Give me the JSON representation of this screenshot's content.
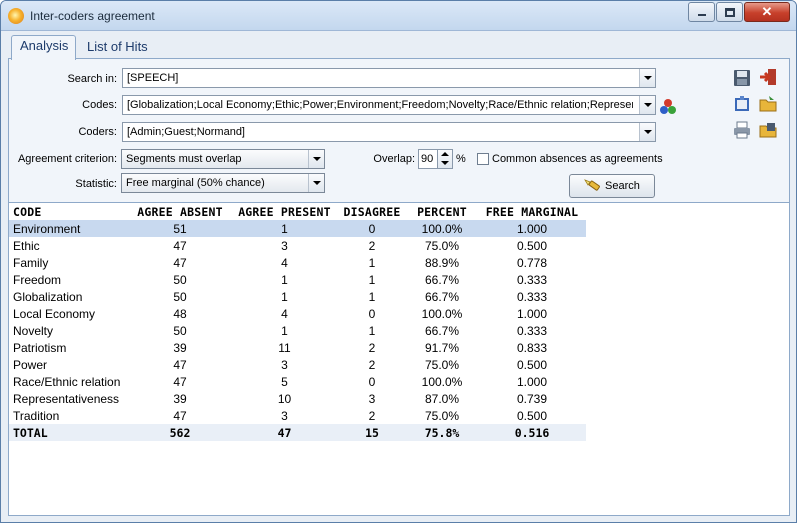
{
  "window": {
    "title": "Inter-coders agreement",
    "buttons": {
      "minimize": "–",
      "maximize": "□",
      "close": "✕"
    }
  },
  "tabs": [
    {
      "label": "Analysis",
      "active": true
    },
    {
      "label": "List of Hits",
      "active": false
    }
  ],
  "form": {
    "search_in": {
      "label": "Search in:",
      "value": "[SPEECH]"
    },
    "codes": {
      "label": "Codes:",
      "value": "[Globalization;Local Economy;Ethic;Power;Environment;Freedom;Novelty;Race/Ethnic relation;Representa"
    },
    "coders": {
      "label": "Coders:",
      "value": "[Admin;Guest;Normand]"
    },
    "criterion": {
      "label": "Agreement criterion:",
      "value": "Segments must overlap"
    },
    "statistic": {
      "label": "Statistic:",
      "value": "Free marginal  (50% chance)"
    },
    "overlap": {
      "label": "Overlap:",
      "value": "90",
      "unit": "%"
    },
    "common_absences": {
      "label": "Common absences as agreements",
      "checked": false
    },
    "search_button": "Search"
  },
  "icons": [
    "save-icon",
    "exit-icon",
    "codes-color-icon",
    "book-icon",
    "open-folder-icon",
    "print-icon",
    "export-icon",
    "search-flashlight-icon"
  ],
  "table": {
    "columns": [
      "CODE",
      "AGREE ABSENT",
      "AGREE PRESENT",
      "DISAGREE",
      "PERCENT",
      "FREE MARGINAL"
    ],
    "rows": [
      [
        "Environment",
        "51",
        "1",
        "0",
        "100.0%",
        "1.000"
      ],
      [
        "Ethic",
        "47",
        "3",
        "2",
        "75.0%",
        "0.500"
      ],
      [
        "Family",
        "47",
        "4",
        "1",
        "88.9%",
        "0.778"
      ],
      [
        "Freedom",
        "50",
        "1",
        "1",
        "66.7%",
        "0.333"
      ],
      [
        "Globalization",
        "50",
        "1",
        "1",
        "66.7%",
        "0.333"
      ],
      [
        "Local Economy",
        "48",
        "4",
        "0",
        "100.0%",
        "1.000"
      ],
      [
        "Novelty",
        "50",
        "1",
        "1",
        "66.7%",
        "0.333"
      ],
      [
        "Patriotism",
        "39",
        "11",
        "2",
        "91.7%",
        "0.833"
      ],
      [
        "Power",
        "47",
        "3",
        "2",
        "75.0%",
        "0.500"
      ],
      [
        "Race/Ethnic relation",
        "47",
        "5",
        "0",
        "100.0%",
        "1.000"
      ],
      [
        "Representativeness",
        "39",
        "10",
        "3",
        "87.0%",
        "0.739"
      ],
      [
        "Tradition",
        "47",
        "3",
        "2",
        "75.0%",
        "0.500"
      ]
    ],
    "total": [
      "TOTAL",
      "562",
      "47",
      "15",
      "75.8%",
      "0.516"
    ],
    "selected_row": 0
  },
  "colors": {
    "selection": "#c8d9ef",
    "total_row": "#e9eff7",
    "window_bg": "#e8eef5"
  }
}
